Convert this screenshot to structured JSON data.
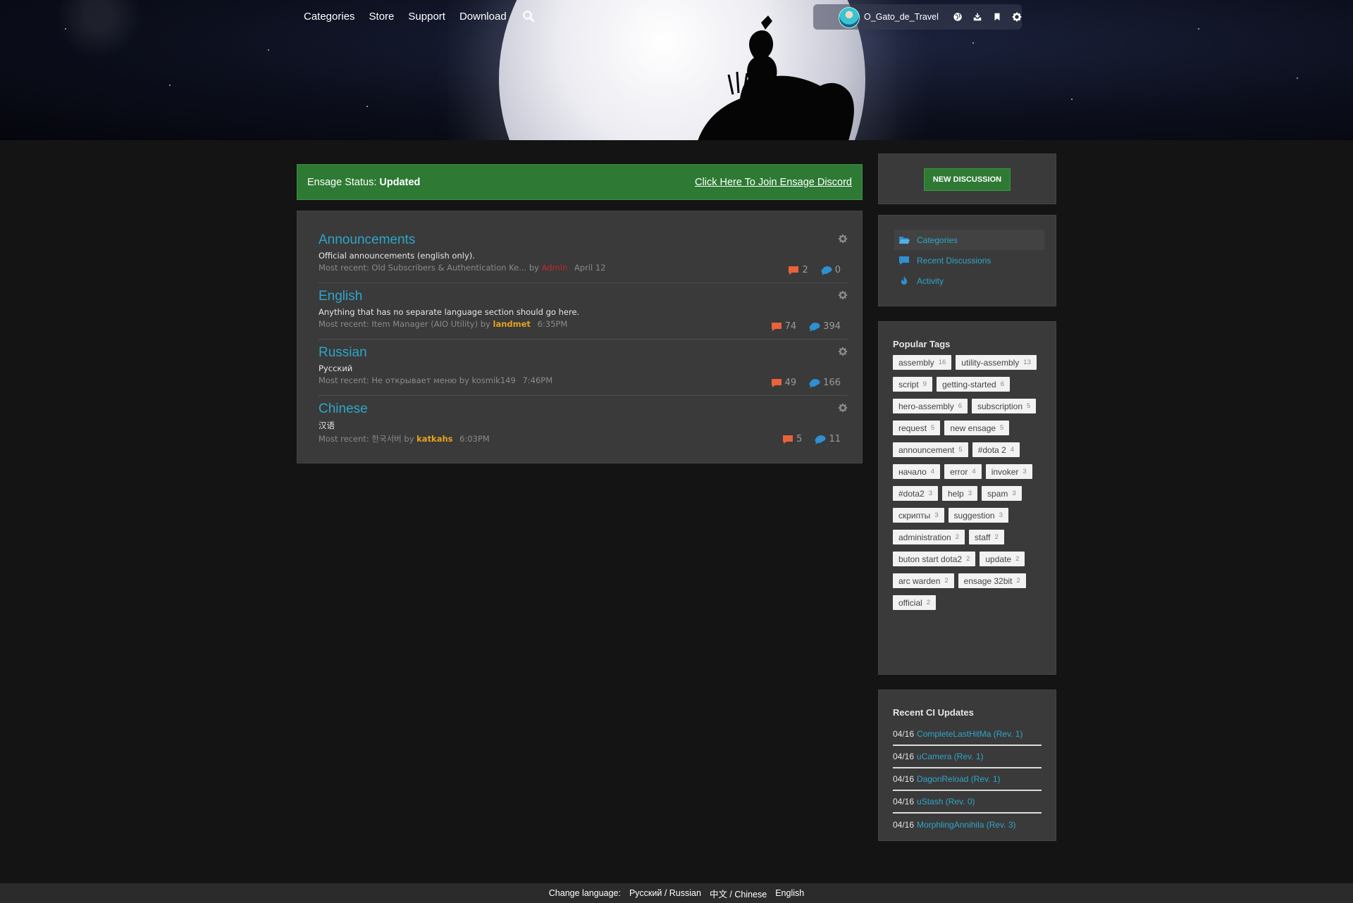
{
  "nav": {
    "items": [
      "Categories",
      "Store",
      "Support",
      "Download"
    ]
  },
  "user": {
    "name": "O_Gato_de_Travel"
  },
  "status": {
    "label": "Ensage Status:",
    "value": "Updated",
    "discord_link": "Click Here To Join Ensage Discord"
  },
  "categories": [
    {
      "title": "Announcements",
      "description": "Official announcements (english only).",
      "recent_prefix": "Most recent:",
      "recent_title": "Old Subscribers & Authentication Ke...",
      "by": "by",
      "author": "Admin",
      "author_color": "red",
      "time": "April 12",
      "discussions": "2",
      "comments": "0"
    },
    {
      "title": "English",
      "description": "Anything that has no separate language section should go here.",
      "recent_prefix": "Most recent:",
      "recent_title": "Item Manager (AIO Utility)",
      "by": "by",
      "author": "landmet",
      "author_color": "orange",
      "time": "6:35PM",
      "discussions": "74",
      "comments": "394"
    },
    {
      "title": "Russian",
      "description": "Русский",
      "recent_prefix": "Most recent:",
      "recent_title": "Не открывает меню",
      "by": "by",
      "author": "kosmik149",
      "author_color": "plain",
      "time": "7:46PM",
      "discussions": "49",
      "comments": "166"
    },
    {
      "title": "Chinese",
      "description": "汉语",
      "recent_prefix": "Most recent:",
      "recent_title": "한국서버",
      "by": "by",
      "author": "katkahs",
      "author_color": "orange",
      "time": "6:03PM",
      "discussions": "5",
      "comments": "11"
    }
  ],
  "sidebar": {
    "new_discussion": "NEW DISCUSSION",
    "menu": [
      {
        "label": "Categories",
        "icon": "folder-icon"
      },
      {
        "label": "Recent Discussions",
        "icon": "chat-icon"
      },
      {
        "label": "Activity",
        "icon": "flame-icon"
      }
    ],
    "tags_title": "Popular Tags",
    "tags": [
      {
        "name": "assembly",
        "count": "16"
      },
      {
        "name": "utility-assembly",
        "count": "13"
      },
      {
        "name": "script",
        "count": "9"
      },
      {
        "name": "getting-started",
        "count": "6"
      },
      {
        "name": "hero-assembly",
        "count": "6"
      },
      {
        "name": "subscription",
        "count": "5"
      },
      {
        "name": "request",
        "count": "5"
      },
      {
        "name": "new ensage",
        "count": "5"
      },
      {
        "name": "announcement",
        "count": "5"
      },
      {
        "name": "#dota 2",
        "count": "4"
      },
      {
        "name": "начало",
        "count": "4"
      },
      {
        "name": "error",
        "count": "4"
      },
      {
        "name": "invoker",
        "count": "3"
      },
      {
        "name": "#dota2",
        "count": "3"
      },
      {
        "name": "help",
        "count": "3"
      },
      {
        "name": "spam",
        "count": "3"
      },
      {
        "name": "скрипты",
        "count": "3"
      },
      {
        "name": "suggestion",
        "count": "3"
      },
      {
        "name": "administration",
        "count": "2"
      },
      {
        "name": "staff",
        "count": "2"
      },
      {
        "name": "buton start dota2",
        "count": "2"
      },
      {
        "name": "update",
        "count": "2"
      },
      {
        "name": "arc warden",
        "count": "2"
      },
      {
        "name": "ensage 32bit",
        "count": "2"
      },
      {
        "name": "official",
        "count": "2"
      }
    ],
    "ci_title": "Recent CI Updates",
    "ci_updates": [
      {
        "date": "04/16",
        "name": "CompleteLastHitMa (Rev. 1)"
      },
      {
        "date": "04/16",
        "name": "uCamera (Rev. 1)"
      },
      {
        "date": "04/16",
        "name": "DagonReload (Rev. 1)"
      },
      {
        "date": "04/16",
        "name": "uStash (Rev. 0)"
      },
      {
        "date": "04/16",
        "name": "MorphlingAnnihila (Rev. 3)"
      }
    ]
  },
  "footer": {
    "label": "Change language:",
    "languages": [
      "Русский / Russian",
      "中文 / Chinese",
      "English"
    ]
  },
  "colors": {
    "accent": "#2fa5c9",
    "status_green": "#2e7a34",
    "author_orange": "#e5a21c",
    "author_red": "#c7262d",
    "discussion_icon": "#e8623a",
    "comment_icon": "#2f8fd0"
  }
}
